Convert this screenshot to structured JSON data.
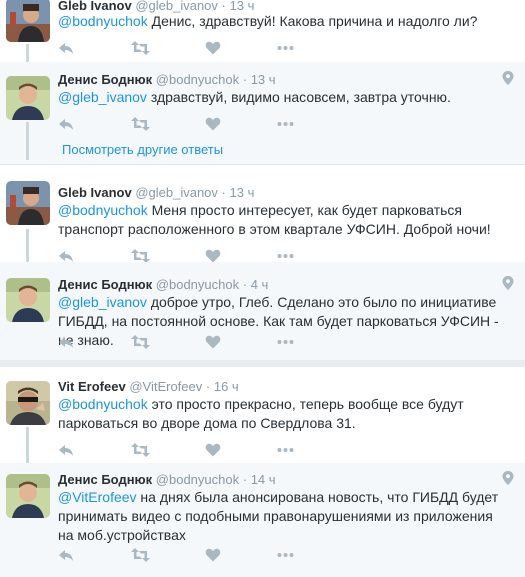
{
  "colors": {
    "background": "#e6ecf0",
    "card": "#ffffff",
    "shaded": "#f5f8fa",
    "link": "#1b95e0",
    "muted": "#8899a6",
    "thread_line": "#ccd6dd",
    "icon": "#aab8c2"
  },
  "tweets": [
    {
      "fullname": "Gleb Ivanov",
      "username": "@gleb_ivanov",
      "dot": "·",
      "time": "13 ч",
      "mention": "@bodnyuchok",
      "text": " Денис, здравствуй! Какова причина и надолго ли?",
      "avatar_icon": "avatar-gleb",
      "has_geo": false
    },
    {
      "fullname": "Денис Боднюк",
      "username": "@bodnyuchok",
      "dot": "·",
      "time": "13 ч",
      "mention": "@gleb_ivanov",
      "text": " здравствуй, видимо насовсем, завтра уточню.",
      "avatar_icon": "avatar-denis",
      "has_geo": true
    },
    {
      "fullname": "Gleb Ivanov",
      "username": "@gleb_ivanov",
      "dot": "·",
      "time": "13 ч",
      "mention": "@bodnyuchok",
      "text": " Меня просто интересует, как будет парковаться транспорт расположенного в этом квартале УФСИН. Доброй ночи!",
      "avatar_icon": "avatar-gleb",
      "has_geo": false
    },
    {
      "fullname": "Денис Боднюк",
      "username": "@bodnyuchok",
      "dot": "·",
      "time": "4 ч",
      "mention": "@gleb_ivanov",
      "text": " доброе утро, Глеб. Сделано это было по инициативе ГИБДД, на постоянной основе. Как там будет парковаться УФСИН - не знаю.",
      "avatar_icon": "avatar-denis",
      "has_geo": true
    },
    {
      "fullname": "Vit Erofeev",
      "username": "@VitErofeev",
      "dot": "·",
      "time": "16 ч",
      "mention": "@bodnyuchok",
      "text": " это просто прекрасно, теперь вообще все будут парковаться во дворе дома по Свердлова 31.",
      "avatar_icon": "avatar-vit",
      "has_geo": false
    },
    {
      "fullname": "Денис Боднюк",
      "username": "@bodnyuchok",
      "dot": "·",
      "time": "14 ч",
      "mention": "@VitErofeev",
      "text": " на днях была анонсирована новость, что ГИБДД будет принимать видео с подобными правонарушениями из приложения на моб.устройствах",
      "avatar_icon": "avatar-denis",
      "has_geo": true
    }
  ],
  "more_replies_label": "Посмотреть другие ответы",
  "action_icons": [
    "reply-icon",
    "retweet-icon",
    "like-icon",
    "more-icon"
  ]
}
